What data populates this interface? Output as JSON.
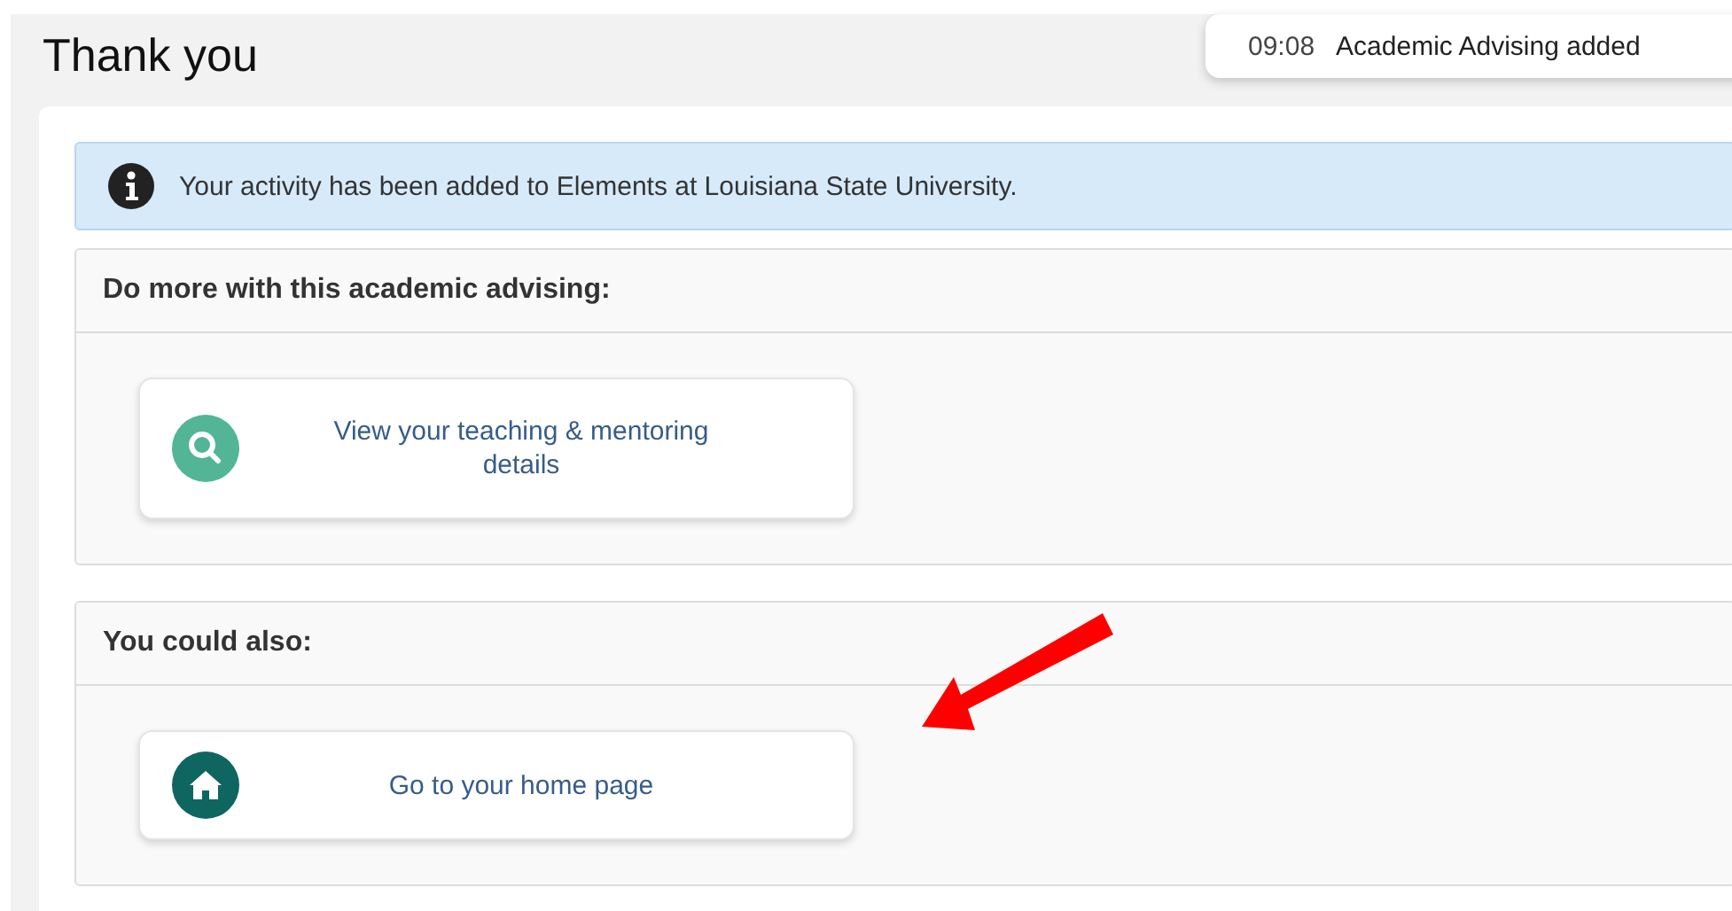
{
  "page_title": "Thank you",
  "toast": {
    "time": "09:08",
    "message": "Academic Advising added"
  },
  "alert": {
    "message": "Your activity has been added to Elements at Louisiana State University."
  },
  "panels": [
    {
      "heading": "Do more with this academic advising:",
      "actions": [
        {
          "kind": "search",
          "label": "View your teaching & mentoring details"
        }
      ]
    },
    {
      "heading": "You could also:",
      "actions": [
        {
          "kind": "home",
          "label": "Go to your home page"
        }
      ]
    }
  ]
}
